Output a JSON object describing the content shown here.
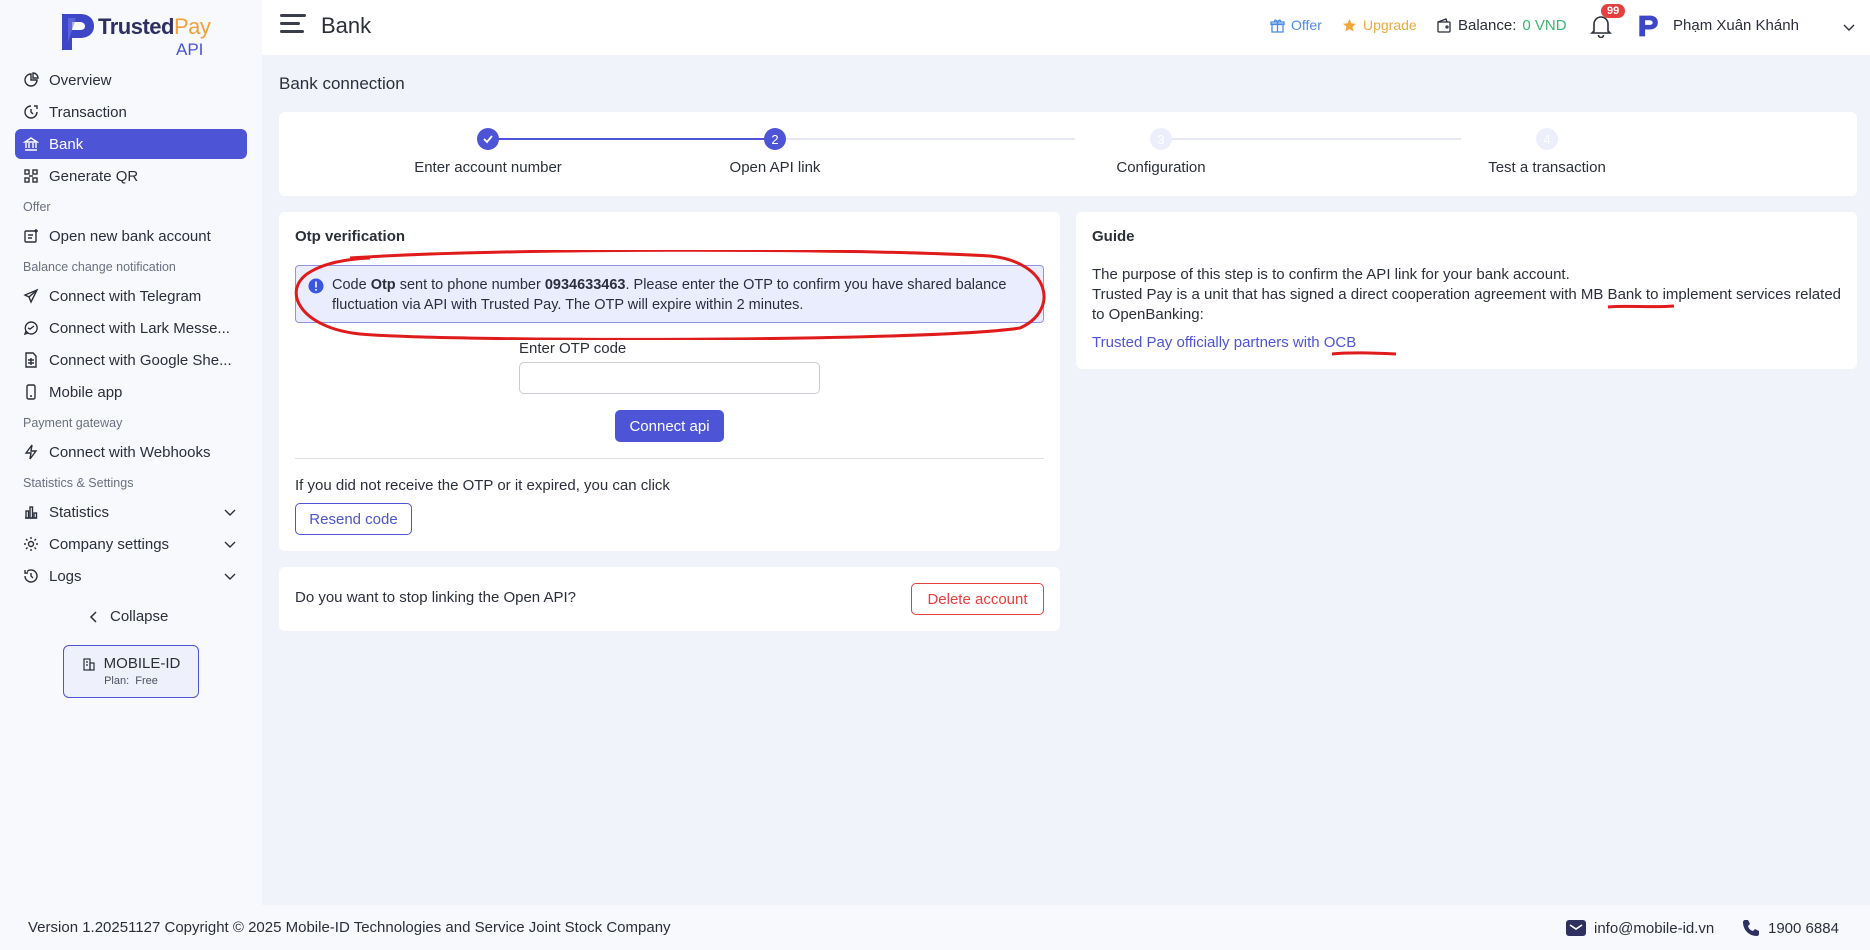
{
  "brand": {
    "name_part1": "Trusted",
    "name_part2": "Pay",
    "suffix": "API"
  },
  "header": {
    "title": "Bank",
    "offer_label": "Offer",
    "upgrade_label": "Upgrade",
    "balance_label": "Balance:",
    "balance_value": "0 VND",
    "notification_count": "99",
    "user_name": "Phạm Xuân Khánh"
  },
  "sidebar": {
    "items": [
      {
        "label": "Overview",
        "icon": "pie-chart-icon"
      },
      {
        "label": "Transaction",
        "icon": "transaction-icon"
      },
      {
        "label": "Bank",
        "icon": "bank-icon",
        "active": true
      },
      {
        "label": "Generate QR",
        "icon": "qr-icon"
      }
    ],
    "group_offer": "Offer",
    "offer_items": [
      {
        "label": "Open new bank account",
        "icon": "new-account-icon"
      }
    ],
    "group_notify": "Balance change notification",
    "notify_items": [
      {
        "label": "Connect with Telegram",
        "icon": "telegram-icon"
      },
      {
        "label": "Connect with Lark Messe...",
        "icon": "chat-icon"
      },
      {
        "label": "Connect with Google She...",
        "icon": "sheet-icon"
      },
      {
        "label": "Mobile app",
        "icon": "mobile-icon"
      }
    ],
    "group_gateway": "Payment gateway",
    "gateway_items": [
      {
        "label": "Connect with Webhooks",
        "icon": "lightning-icon"
      }
    ],
    "group_stats": "Statistics & Settings",
    "stats_items": [
      {
        "label": "Statistics",
        "icon": "bar-chart-icon"
      },
      {
        "label": "Company settings",
        "icon": "gear-icon"
      },
      {
        "label": "Logs",
        "icon": "history-icon"
      }
    ],
    "collapse_label": "Collapse",
    "org_name": "MOBILE-ID",
    "org_plan_label": "Plan:",
    "org_plan_value": "Free"
  },
  "main": {
    "section_title": "Bank connection",
    "steps": [
      {
        "label": "Enter account number",
        "state": "done",
        "number": "1"
      },
      {
        "label": "Open API link",
        "state": "current",
        "number": "2"
      },
      {
        "label": "Configuration",
        "state": "pending",
        "number": "3"
      },
      {
        "label": "Test a transaction",
        "state": "pending",
        "number": "4"
      }
    ],
    "otp": {
      "title": "Otp verification",
      "alert_pre": "Code ",
      "alert_bold1": "Otp",
      "alert_mid": " sent to phone number ",
      "alert_phone": "0934633463",
      "alert_post": ". Please enter the OTP to confirm you have shared balance fluctuation via API with Trusted Pay. The OTP will expire within 2 minutes.",
      "input_label": "Enter OTP code",
      "input_value": "",
      "connect_label": "Connect api",
      "resend_prompt": "If you did not receive the OTP or it expired, you can click",
      "resend_label": "Resend code"
    },
    "stop": {
      "question": "Do you want to stop linking the Open API?",
      "delete_label": "Delete account"
    },
    "guide": {
      "title": "Guide",
      "line1": "The purpose of this step is to confirm the API link for your bank account.",
      "line2_pre": "Trusted Pay is a unit that has signed a direct cooperation agreement with ",
      "line2_bank": "MB Bank",
      "line2_post": " to implement services related to OpenBanking:",
      "link_text": "Trusted Pay officially partners with OCB"
    }
  },
  "footer": {
    "copyright": "Version 1.20251127 Copyright © 2025 Mobile-ID Technologies and Service Joint Stock Company",
    "email": "info@mobile-id.vn",
    "phone": "1900 6884"
  },
  "colors": {
    "accent": "#4d54d6",
    "danger": "#e53f3f",
    "annotation": "#e01b1b",
    "balance": "#3cb46d"
  }
}
